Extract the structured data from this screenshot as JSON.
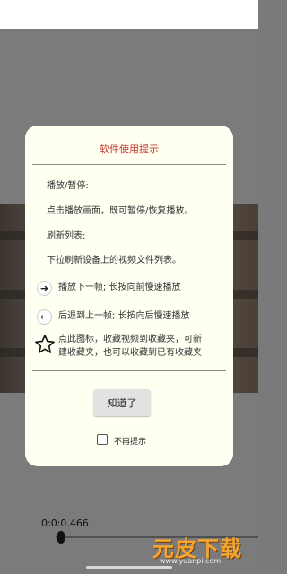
{
  "dialog": {
    "title": "软件使用提示",
    "section1_heading": "播放/暂停:",
    "section1_text": "点击播放画面，既可暂停/恢复播放。",
    "section2_heading": "刷新列表:",
    "section2_text": "下拉刷新设备上的视频文件列表。",
    "next_frame_text": "播放下一帧; 长按向前慢速播放",
    "prev_frame_text": "后退到上一帧; 长按向后慢速播放",
    "favorite_text_line1": "点此图标，收藏视频到收藏夹，可新",
    "favorite_text_line2": "建收藏夹，也可以收藏到已有收藏夹",
    "ok_button": "知道了",
    "dont_show_label": "不再提示",
    "dont_show_checked": false
  },
  "player": {
    "timecode": "0:0:0.466"
  },
  "watermark": {
    "brand": "元皮下载",
    "url": "www.yuanpi.com"
  },
  "colors": {
    "title": "#c0392b",
    "dialog_bg": "#fffff2",
    "watermark": "#f2a531"
  }
}
